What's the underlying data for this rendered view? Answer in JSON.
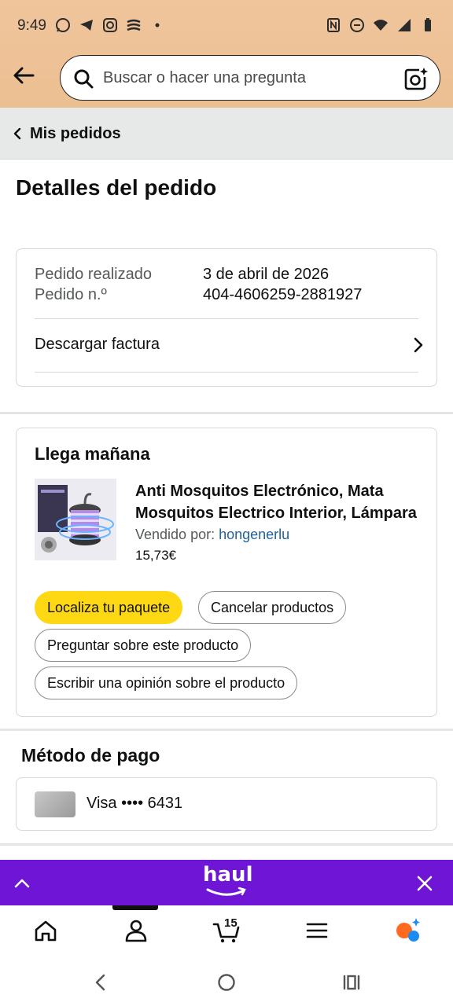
{
  "status_bar": {
    "time": "9:49"
  },
  "search": {
    "placeholder": "Buscar o hacer una pregunta"
  },
  "breadcrumb": {
    "label": "Mis pedidos"
  },
  "page": {
    "title": "Detalles del pedido"
  },
  "order": {
    "placed_label": "Pedido realizado",
    "placed_value": "3 de abril de 2026",
    "number_label": "Pedido n.º",
    "number_value": "404-4606259-2881927",
    "invoice_label": "Descargar factura"
  },
  "delivery": {
    "heading": "Llega mañana",
    "product": {
      "title": "Anti Mosquitos Electrónico, Mata Mosquitos Electrico Interior, Lámpara",
      "sold_by_label": "Vendido por:",
      "seller": "hongenerlu",
      "price": "15,73€"
    },
    "buttons": {
      "track": "Localiza tu paquete",
      "cancel": "Cancelar productos",
      "ask": "Preguntar sobre este producto",
      "review": "Escribir una opinión sobre el producto"
    }
  },
  "payment": {
    "heading": "Método de pago",
    "card_text": "Visa •••• 6431"
  },
  "haul_banner": {
    "logo_text": "haul"
  },
  "bottom_nav": {
    "items": [
      "home-icon",
      "account-icon",
      "cart-icon",
      "menu-icon",
      "rufus-icon"
    ],
    "cart_count": "15"
  },
  "colors": {
    "header_bg": "#ecbf92",
    "primary_button": "#ffd814",
    "haul_purple": "#6e15d6",
    "link": "#2162a1"
  }
}
